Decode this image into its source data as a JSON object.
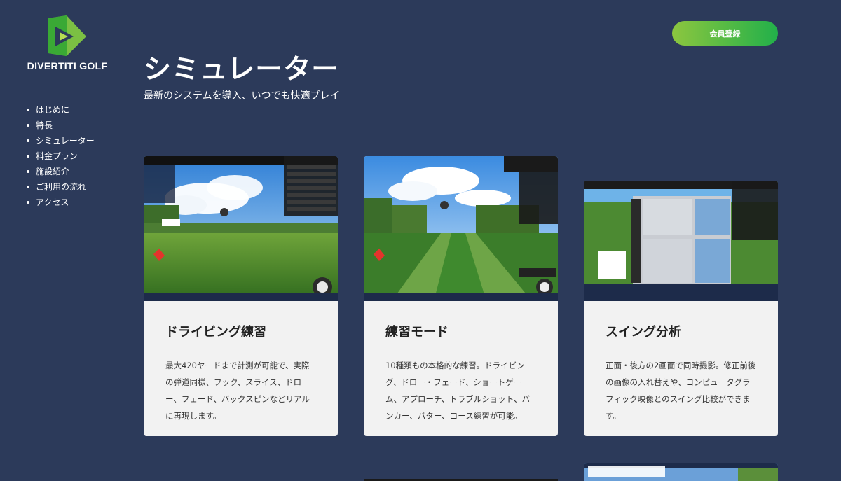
{
  "brand": {
    "logo_text": "DIVERTITI GOLF"
  },
  "header": {
    "signup_label": "会員登録"
  },
  "page": {
    "title": "シミュレーター",
    "subtitle": "最新のシステムを導入、いつでも快適プレイ"
  },
  "sidebar": {
    "items": [
      {
        "label": "はじめに"
      },
      {
        "label": "特長"
      },
      {
        "label": "シミュレーター"
      },
      {
        "label": "料金プラン"
      },
      {
        "label": "施設紹介"
      },
      {
        "label": "ご利用の流れ"
      },
      {
        "label": "アクセス"
      }
    ]
  },
  "cards": [
    {
      "title": "ドライビング練習",
      "text": "最大420ヤードまで計測が可能で、実際の弾道同様、フック、スライス、ドロー、フェード、バックスピンなどリアルに再現します。"
    },
    {
      "title": "練習モード",
      "text": "10種類もの本格的な練習。ドライビング、ドロー・フェード、ショートゲーム、アプローチ、トラブルショット、バンカー、パター、コース練習が可能。"
    },
    {
      "title": "スイング分析",
      "text": "正面・後方の2画面で同時撮影。修正前後の画像の入れ替えや、コンピュータグラフィック映像とのスイング比較ができます。"
    }
  ],
  "colors": {
    "background": "#2c3a5a",
    "accent_start": "#8cc63f",
    "accent_end": "#22b04a",
    "card_bg": "#f2f2f2"
  }
}
